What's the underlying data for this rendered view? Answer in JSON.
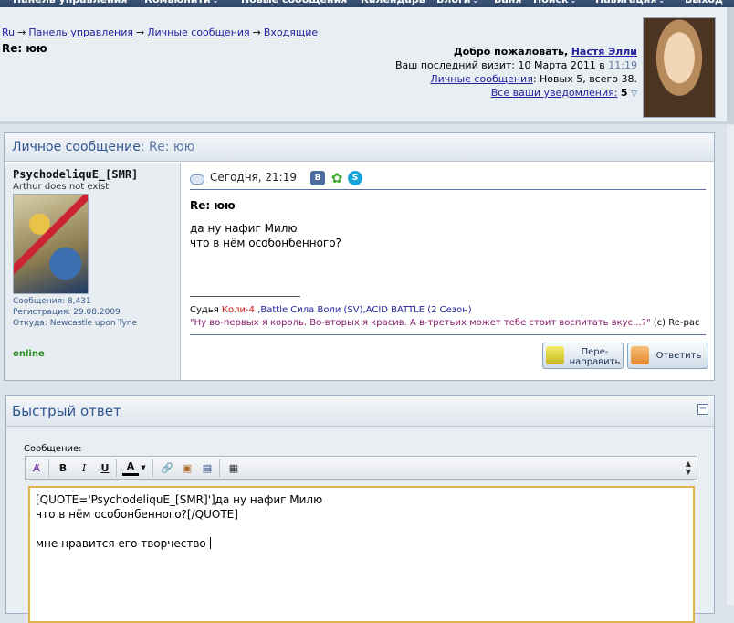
{
  "nav": {
    "items": [
      {
        "label": "Панель управления",
        "dropdown": false
      },
      {
        "label": "Комьюнити",
        "dropdown": true
      },
      {
        "label": "Новые сообщения",
        "dropdown": false
      },
      {
        "label": "Календарь",
        "dropdown": false
      },
      {
        "label": "Блоги",
        "dropdown": true
      },
      {
        "label": "Ваня",
        "dropdown": false
      },
      {
        "label": "Поиск",
        "dropdown": true
      },
      {
        "label": "Навигация",
        "dropdown": true
      },
      {
        "label": "Выход",
        "dropdown": false
      }
    ]
  },
  "breadcrumb": {
    "items": [
      "Ru",
      "Панель управления",
      "Личные сообщения",
      "Входящие"
    ],
    "separator": "→"
  },
  "page_title": "Re: юю",
  "welcome": {
    "greeting": "Добро пожаловать,",
    "user": "Настя Элли",
    "last_visit_label": "Ваш последний визит: 10 Марта 2011 в",
    "last_visit_time": "11:19",
    "pm_link": "Личные сообщения",
    "pm_counts": ": Новых 5, всего 38.",
    "notif_link": "Все ваши уведомления:",
    "notif_count": "5"
  },
  "pm": {
    "header_prefix": "Личное сообщение",
    "header_subject": ": Re: юю",
    "author": {
      "name": "PsychodeliquE_[SMR]",
      "title": "Arthur does not exist",
      "posts": "Сообщения: 8,431",
      "registered": "Регистрация: 29.08.2009",
      "location": "Откуда: Newcastle upon Tyne",
      "status": "online"
    },
    "date": "Сегодня, 21:19",
    "subject": "Re: юю",
    "body": "да ну нафиг Милю\nчто в нём особонбенного?",
    "signature": {
      "l1a": "Судья ",
      "l1b": "Коли-4",
      "l1c": " ,Battle Сила Воли (SV),ACID BATTLE (2 Сезон)",
      "l2a": "\"Ну во-первых я король. Во-вторых я красив. А в-третьих может тебе стоит воспитать вкус...?\"",
      "l2b": " (c) Re-pac"
    },
    "forward_label": "Пере-\nнаправить",
    "reply_label": "Ответить"
  },
  "quick_reply": {
    "title": "Быстрый ответ",
    "message_label": "Сообщение:",
    "collapse": "−",
    "text": "[QUOTE='PsychodeliquE_[SMR]']да ну нафиг Милю\nчто в нём особонбенного?[/QUOTE]\n\nмне нравится его творчество "
  },
  "toolbar": {
    "bold": "B",
    "italic": "I",
    "underline": "U",
    "font_color": "A"
  },
  "colors": {
    "accent": "#2f5590",
    "link": "#22229c",
    "online": "#2a8a1f"
  }
}
